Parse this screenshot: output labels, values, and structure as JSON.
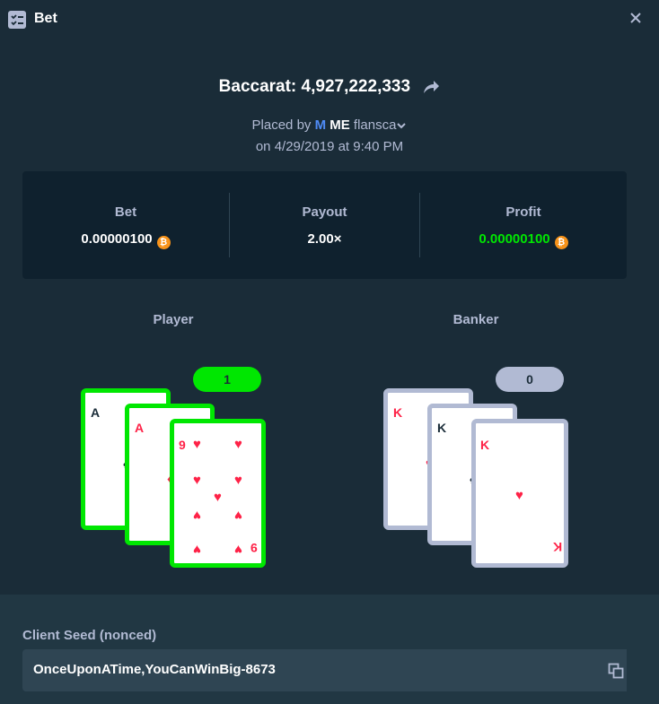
{
  "header": {
    "title": "Bet",
    "icon": "checklist-icon",
    "close_icon": "close-icon"
  },
  "bet": {
    "title": "Baccarat: 4,927,222,333",
    "placed_by_prefix": "Placed by",
    "user_badge": "M",
    "user_name_bold": "ME",
    "user_name": "flansca",
    "date_line": "on 4/29/2019 at 9:40 PM"
  },
  "stats": {
    "bet_label": "Bet",
    "bet_value": "0.00000100",
    "payout_label": "Payout",
    "payout_value": "2.00×",
    "profit_label": "Profit",
    "profit_value": "0.00000100",
    "currency_icon": "bitcoin-icon",
    "profit_color": "#00e701"
  },
  "hands": {
    "player": {
      "label": "Player",
      "score": "1",
      "score_color": "#00e701",
      "cards": [
        {
          "rank": "A",
          "suit": "spades"
        },
        {
          "rank": "A",
          "suit": "diamonds"
        },
        {
          "rank": "9",
          "suit": "hearts"
        }
      ]
    },
    "banker": {
      "label": "Banker",
      "score": "0",
      "score_color": "#b1bad3",
      "cards": [
        {
          "rank": "K",
          "suit": "hearts"
        },
        {
          "rank": "K",
          "suit": "spades"
        },
        {
          "rank": "K",
          "suit": "hearts"
        }
      ]
    }
  },
  "seed": {
    "label": "Client Seed (nonced)",
    "value": "OnceUponATime,YouCanWinBig-8673",
    "copy_icon": "copy-icon"
  }
}
